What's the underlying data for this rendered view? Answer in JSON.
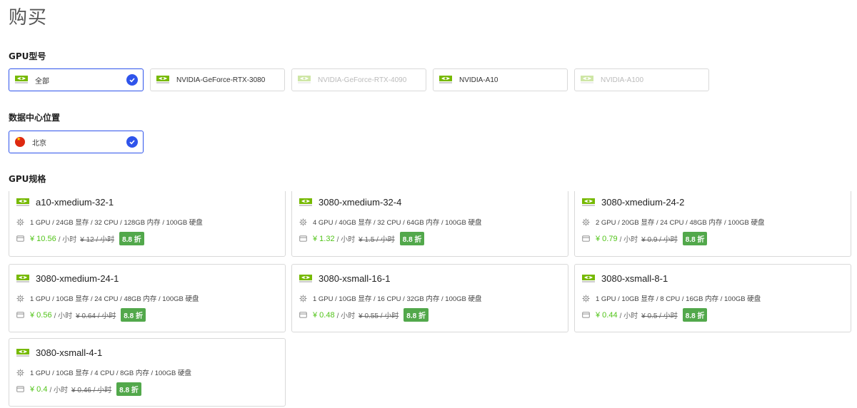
{
  "page_title": "购买",
  "sections": {
    "gpu_model": "GPU型号",
    "datacenter": "数据中心位置",
    "gpu_spec": "GPU规格"
  },
  "gpu_models": [
    {
      "label": "全部",
      "selected": true,
      "disabled": false
    },
    {
      "label": "NVIDIA-GeForce-RTX-3080",
      "selected": false,
      "disabled": false
    },
    {
      "label": "NVIDIA-GeForce-RTX-4090",
      "selected": false,
      "disabled": true
    },
    {
      "label": "NVIDIA-A10",
      "selected": false,
      "disabled": false
    },
    {
      "label": "NVIDIA-A100",
      "selected": false,
      "disabled": true
    }
  ],
  "datacenters": [
    {
      "label": "北京",
      "selected": true,
      "flag": "china-flag-icon"
    }
  ],
  "specs": [
    {
      "name": "a10-xmedium-32-1",
      "specs": "1 GPU / 24GB 显存 / 32 CPU / 128GB 内存 / 100GB 硬盘",
      "price": "¥ 10.56",
      "unit": "/ 小时",
      "original": "¥ 12 / 小时",
      "discount": "8.8 折"
    },
    {
      "name": "3080-xmedium-32-4",
      "specs": "4 GPU / 40GB 显存 / 32 CPU / 64GB 内存 / 100GB 硬盘",
      "price": "¥ 1.32",
      "unit": "/ 小时",
      "original": "¥ 1.5 / 小时",
      "discount": "8.8 折"
    },
    {
      "name": "3080-xmedium-24-2",
      "specs": "2 GPU / 20GB 显存 / 24 CPU / 48GB 内存 / 100GB 硬盘",
      "price": "¥ 0.79",
      "unit": "/ 小时",
      "original": "¥ 0.9 / 小时",
      "discount": "8.8 折"
    },
    {
      "name": "3080-xmedium-24-1",
      "specs": "1 GPU / 10GB 显存 / 24 CPU / 48GB 内存 / 100GB 硬盘",
      "price": "¥ 0.56",
      "unit": "/ 小时",
      "original": "¥ 0.64 / 小时",
      "discount": "8.8 折"
    },
    {
      "name": "3080-xsmall-16-1",
      "specs": "1 GPU / 10GB 显存 / 16 CPU / 32GB 内存 / 100GB 硬盘",
      "price": "¥ 0.48",
      "unit": "/ 小时",
      "original": "¥ 0.55 / 小时",
      "discount": "8.8 折"
    },
    {
      "name": "3080-xsmall-8-1",
      "specs": "1 GPU / 10GB 显存 / 8 CPU / 16GB 内存 / 100GB 硬盘",
      "price": "¥ 0.44",
      "unit": "/ 小时",
      "original": "¥ 0.5 / 小时",
      "discount": "8.8 折"
    },
    {
      "name": "3080-xsmall-4-1",
      "specs": "1 GPU / 10GB 显存 / 4 CPU / 8GB 内存 / 100GB 硬盘",
      "price": "¥ 0.4",
      "unit": "/ 小时",
      "original": "¥ 0.46 / 小时",
      "discount": "8.8 折"
    }
  ],
  "colors": {
    "accent": "#2f54eb",
    "price": "#52c41a",
    "badge": "#52a84b"
  },
  "icons": {
    "vendor": "nvidia-logo-icon",
    "spec": "chip-gear-icon",
    "price": "card-icon",
    "selected": "check-circle-icon"
  }
}
